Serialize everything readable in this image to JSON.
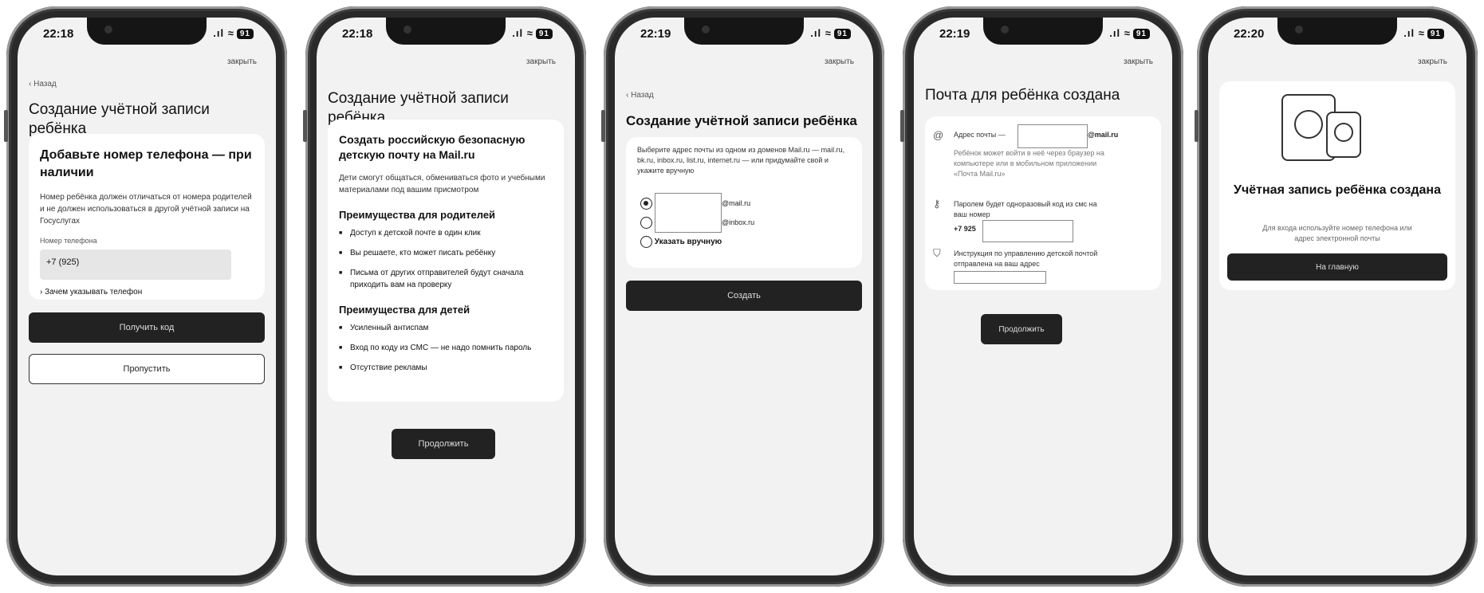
{
  "status": {
    "battery": "91",
    "signal": ".ıl ≈"
  },
  "common": {
    "close": "закрыть",
    "back": "‹ Назад"
  },
  "phones": [
    {
      "time": "22:18",
      "title": "Создание учётной записи ребёнка",
      "heading": "Добавьте номер телефона — при наличии",
      "text": "Номер ребёнка должен отличаться от номера родителей и не должен использоваться в другой учётной записи на Госуслугах",
      "field_label": "Номер телефона",
      "field_value": "+7 (925)",
      "why": "› Зачем указывать телефон",
      "primary": "Получить код",
      "secondary": "Пропустить"
    },
    {
      "time": "22:18",
      "title": "Создание учётной записи ребёнка",
      "heading": "Создать российскую безопасную детскую почту на Mail.ru",
      "text": "Дети смогут общаться, обмениваться фото и учебными материалами под вашим присмотром",
      "parents_title": "Преимущества для родителей",
      "parents": [
        "Доступ к детской почте в один клик",
        "Вы решаете, кто может писать ребёнку",
        "Письма от других отправителей будут сначала приходить вам на проверку"
      ],
      "kids_title": "Преимущества для детей",
      "kids": [
        "Усиленный антиспам",
        "Вход по коду из СМС — не надо помнить пароль",
        "Отсутствие рекламы"
      ],
      "primary": "Продолжить"
    },
    {
      "time": "22:19",
      "title": "Создание учётной записи ребёнка",
      "text": "Выберите адрес почты из одном из доменов Mail.ru — mail.ru, bk.ru, inbox.ru, list.ru, internet.ru — или придумайте свой и укажите вручную",
      "options": [
        "@mail.ru",
        "@inbox.ru",
        "Указать вручную"
      ],
      "primary": "Создать"
    },
    {
      "time": "22:19",
      "title": "Почта для ребёнка создана",
      "mail_label": "Адрес почты —",
      "mail_domain": "@mail.ru",
      "mail_note": "Ребёнок может войти в неё через браузер на компьютере или в мобильном приложении «Почта Mail.ru»",
      "pass_text": "Паролем будет одноразовый код из смс на ваш номер",
      "pass_phone": "+7 925",
      "instr_text": "Инструкция по управлению детской почтой отправлена на ваш адрес",
      "primary": "Продолжить"
    },
    {
      "time": "22:20",
      "heading": "Учётная запись ребёнка создана",
      "text": "Для входа используйте номер телефона или адрес электронной почты",
      "primary": "На главную"
    }
  ]
}
